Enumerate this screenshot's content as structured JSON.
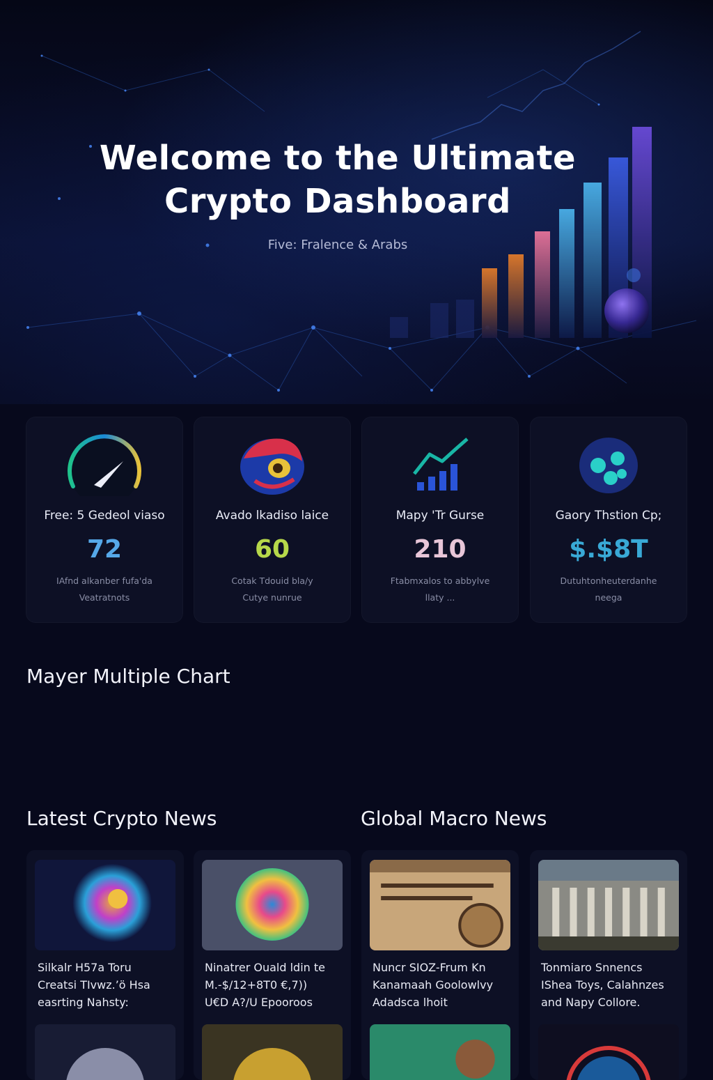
{
  "hero": {
    "title_line1": "Welcome to the Ultimate",
    "title_line2": "Crypto Dashboard",
    "subtitle": "Five: Fralence & Arabs"
  },
  "stats": [
    {
      "label": "Free: 5 Gedeol viaso",
      "value": "72",
      "desc_line1": "IAfnd alkanber fufa'da",
      "desc_line2": "Veatratnots",
      "color": "#56a8e8",
      "icon": "gauge-icon"
    },
    {
      "label": "Avado lkadiso laice",
      "value": "60",
      "desc_line1": "Cotak Tdouid bla∕y",
      "desc_line2": "Cutye nunrue",
      "color": "#b6d84a",
      "icon": "fish-coin-icon"
    },
    {
      "label": "Mapy 'Tr Gurse",
      "value": "210",
      "desc_line1": "Ftabmxalos to abbylve",
      "desc_line2": "llaty ...",
      "color": "#e8c6d8",
      "icon": "trend-chart-icon"
    },
    {
      "label": "Gaory Thstion Cp;",
      "value": "$.$8T",
      "desc_line1": "Dutuhtonheuterdanhe",
      "desc_line2": "neega",
      "color": "#39a9d6",
      "icon": "orb-cluster-icon"
    }
  ],
  "mayer": {
    "title": "Mayer Multiple Chart"
  },
  "crypto_news": {
    "title": "Latest Crypto News",
    "items": [
      {
        "line1": "Silkalr H57a Toru",
        "line2": "Creatsi TIvwz.’ö Hsa",
        "line3": "easrting Nahsty:",
        "icon": "swirl-coin-image"
      },
      {
        "line1": "Ninatrer Ouald ldin te",
        "line2": "M.-$/12+8T0 €,7))",
        "line3": "U€D A?/U  Epooroos",
        "icon": "rainbow-coin-image"
      }
    ]
  },
  "macro_news": {
    "title": "Global Macro News",
    "items": [
      {
        "line1": "Nuncr SIOZ-Frum  Kn",
        "line2": "Kanamaah Goolowlvy",
        "line3": "Adadsca lhoit",
        "icon": "parchment-coin-image"
      },
      {
        "line1": "Tonmiaro Snnencs",
        "line2": "IShea Toys, Calahnzes",
        "line3": "and Napy Collore.",
        "icon": "bank-building-image"
      }
    ]
  }
}
